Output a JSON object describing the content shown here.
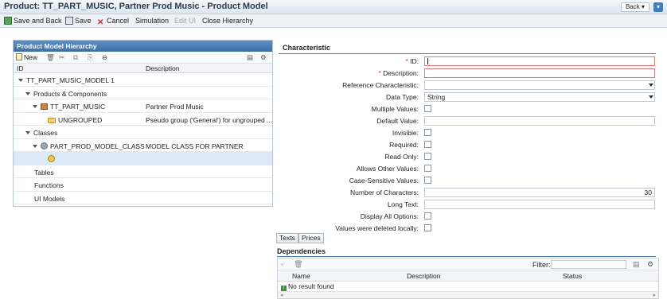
{
  "window": {
    "title": "Product: TT_PART_MUSIC, Partner Prod Music - Product Model",
    "back_label": "Back"
  },
  "toolbar": {
    "save_and_back": "Save and Back",
    "save": "Save",
    "cancel": "Cancel",
    "simulation": "Simulation",
    "edit_ui": "Edit UI",
    "close_hierarchy": "Close Hierarchy"
  },
  "hierarchy": {
    "title": "Product Model Hierarchy",
    "new_label": "New",
    "columns": [
      "ID",
      "Description"
    ],
    "rows": [
      {
        "label": "TT_PART_MUSIC_MODEL 1",
        "description": ""
      },
      {
        "label": "Products & Components",
        "description": ""
      },
      {
        "label": "TT_PART_MUSIC",
        "description": "Partner Prod Music"
      },
      {
        "label": "UNGROUPED",
        "description": "Pseudo group ('General') for ungrouped ..."
      },
      {
        "label": "Classes",
        "description": ""
      },
      {
        "label": "PART_PROD_MODEL_CLASS",
        "description": "MODEL CLASS FOR PARTNER"
      },
      {
        "label": "",
        "description": ""
      },
      {
        "label": "Tables",
        "description": ""
      },
      {
        "label": "Functions",
        "description": ""
      },
      {
        "label": "UI Models",
        "description": ""
      }
    ]
  },
  "characteristic": {
    "title": "Characteristic",
    "fields": {
      "id": {
        "label": "ID:",
        "value": ""
      },
      "description": {
        "label": "Description:",
        "value": ""
      },
      "reference": {
        "label": "Reference Characteristic:",
        "value": ""
      },
      "data_type": {
        "label": "Data Type:",
        "value": "String"
      },
      "multiple_values": {
        "label": "Multiple Values:"
      },
      "default_value": {
        "label": "Default Value:",
        "value": ""
      },
      "invisible": {
        "label": "Invisible:"
      },
      "required": {
        "label": "Required:"
      },
      "read_only": {
        "label": "Read Only:"
      },
      "allows_other": {
        "label": "Allows Other Values:"
      },
      "case_sensitive": {
        "label": "Case-Sensitive Values:"
      },
      "num_chars": {
        "label": "Number of Characters:",
        "value": "30"
      },
      "long_text": {
        "label": "Long Text:",
        "value": ""
      },
      "display_all": {
        "label": "Display All Options:"
      },
      "values_deleted": {
        "label": "Values were deleted locally:"
      }
    },
    "tabs": [
      "Texts",
      "Prices"
    ]
  },
  "dependencies": {
    "title": "Dependencies",
    "filter_label": "Filter:",
    "filter_value": "",
    "columns": [
      "Name",
      "Description",
      "Status"
    ],
    "empty_text": "No result found"
  }
}
